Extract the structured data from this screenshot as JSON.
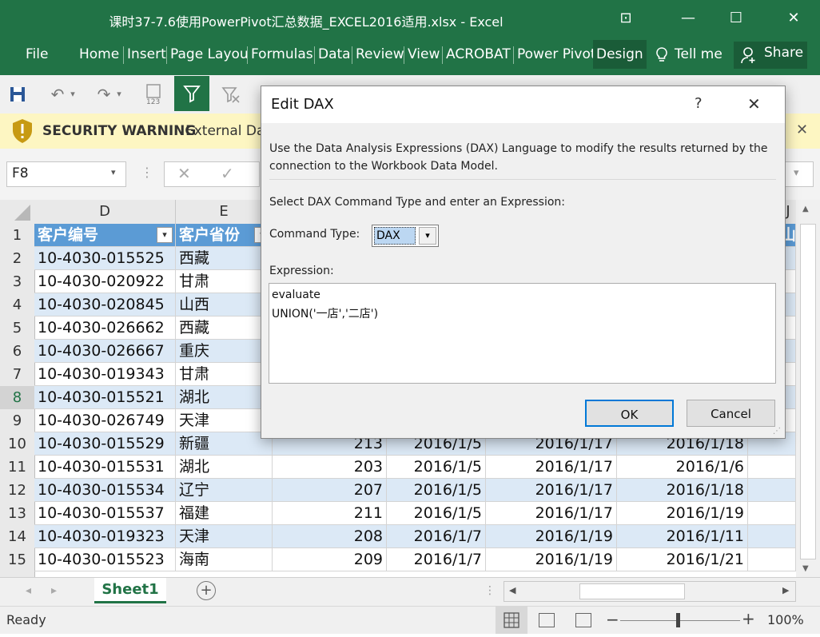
{
  "window": {
    "title": "课时37-7.6使用PowerPivot汇总数据_EXCEL2016适用.xlsx - Excel",
    "controls": [
      "⊡",
      "—",
      "☐",
      "✕"
    ]
  },
  "ribbon": {
    "file": "File",
    "tabs": [
      "Home",
      "Insert",
      "Page Layou",
      "Formulas",
      "Data",
      "Review",
      "View",
      "ACROBAT",
      "Power Pivot",
      "Design"
    ],
    "tell_me": "Tell me",
    "share": "Share"
  },
  "security": {
    "title": "SECURITY WARNING",
    "message": "External Dat"
  },
  "formula_bar": {
    "name_box": "F8",
    "value": ""
  },
  "grid": {
    "col_headers": [
      "D",
      "E",
      "J"
    ],
    "header_row": {
      "row": "1",
      "d": "客户编号",
      "e": "客户省份",
      "j": "山"
    },
    "rows": [
      {
        "row": "2",
        "d": "10-4030-015525",
        "e": "西藏",
        "f": "",
        "g": "",
        "h": "",
        "i": ""
      },
      {
        "row": "3",
        "d": "10-4030-020922",
        "e": "甘肃",
        "f": "",
        "g": "",
        "h": "",
        "i": ""
      },
      {
        "row": "4",
        "d": "10-4030-020845",
        "e": "山西",
        "f": "",
        "g": "",
        "h": "",
        "i": ""
      },
      {
        "row": "5",
        "d": "10-4030-026662",
        "e": "西藏",
        "f": "",
        "g": "",
        "h": "",
        "i": ""
      },
      {
        "row": "6",
        "d": "10-4030-026667",
        "e": "重庆",
        "f": "",
        "g": "",
        "h": "",
        "i": ""
      },
      {
        "row": "7",
        "d": "10-4030-019343",
        "e": "甘肃",
        "f": "",
        "g": "",
        "h": "",
        "i": ""
      },
      {
        "row": "8",
        "d": "10-4030-015521",
        "e": "湖北",
        "f": "",
        "g": "",
        "h": "",
        "i": ""
      },
      {
        "row": "9",
        "d": "10-4030-026749",
        "e": "天津",
        "f": "",
        "g": "",
        "h": "",
        "i": ""
      },
      {
        "row": "10",
        "d": "10-4030-015529",
        "e": "新疆",
        "f": "213",
        "g": "2016/1/5",
        "h": "2016/1/17",
        "i": "2016/1/18"
      },
      {
        "row": "11",
        "d": "10-4030-015531",
        "e": "湖北",
        "f": "203",
        "g": "2016/1/5",
        "h": "2016/1/17",
        "i": "2016/1/6"
      },
      {
        "row": "12",
        "d": "10-4030-015534",
        "e": "辽宁",
        "f": "207",
        "g": "2016/1/5",
        "h": "2016/1/17",
        "i": "2016/1/18"
      },
      {
        "row": "13",
        "d": "10-4030-015537",
        "e": "福建",
        "f": "211",
        "g": "2016/1/5",
        "h": "2016/1/17",
        "i": "2016/1/19"
      },
      {
        "row": "14",
        "d": "10-4030-019323",
        "e": "天津",
        "f": "208",
        "g": "2016/1/7",
        "h": "2016/1/19",
        "i": "2016/1/11"
      },
      {
        "row": "15",
        "d": "10-4030-015523",
        "e": "海南",
        "f": "209",
        "g": "2016/1/7",
        "h": "2016/1/19",
        "i": "2016/1/21"
      }
    ]
  },
  "sheets": {
    "active": "Sheet1"
  },
  "status": {
    "ready": "Ready",
    "zoom": "100%"
  },
  "dialog": {
    "title": "Edit DAX",
    "help": "?",
    "close": "✕",
    "description_line1": "Use the Data Analysis Expressions (DAX) Language to modify the results returned by the",
    "description_line2": "connection to the Workbook Data Model.",
    "instruction": "Select DAX Command Type and enter an Expression:",
    "command_type_label": "Command Type:",
    "command_type_value": "DAX",
    "expression_label": "Expression:",
    "expression_line1": "evaluate",
    "expression_line2": "UNION('一店','二店')",
    "ok": "OK",
    "cancel": "Cancel"
  },
  "colors": {
    "excel_green": "#217346",
    "table_header": "#5b9bd5",
    "band": "#dce9f6",
    "warning_bg": "#fdf6c2"
  }
}
